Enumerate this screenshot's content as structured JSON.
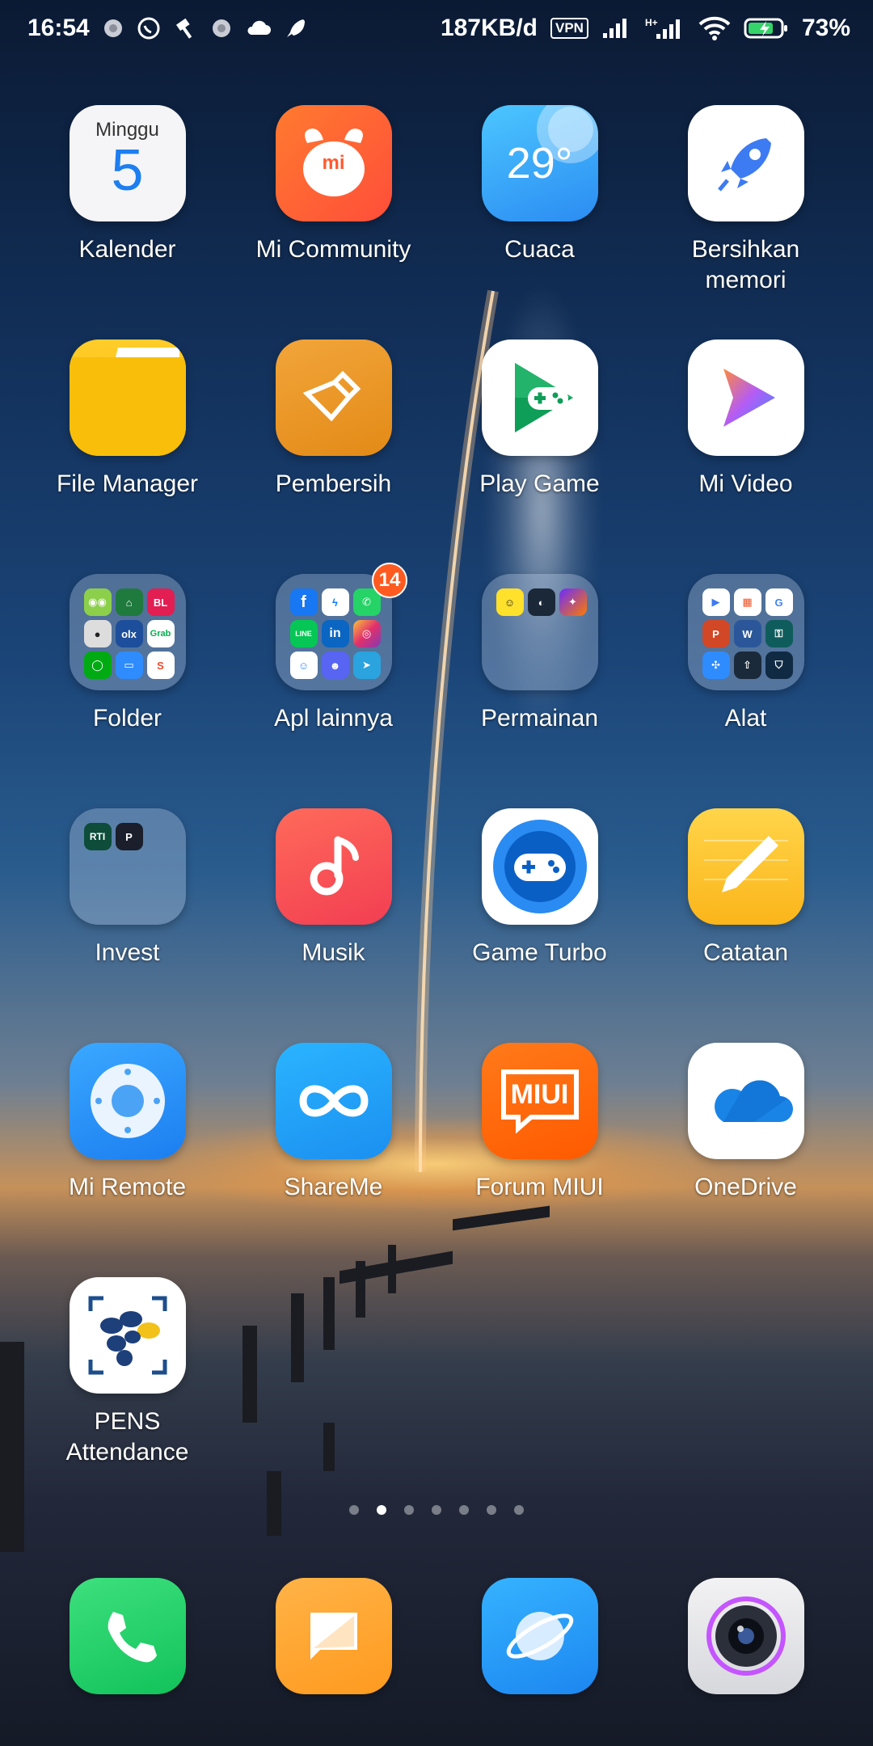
{
  "status_bar": {
    "time": "16:54",
    "speed": "187KB/d",
    "vpn": "VPN",
    "battery": "73%",
    "notification_icons": [
      "circle-icon",
      "whatsapp-icon",
      "hammer-icon",
      "circle-icon",
      "cloud-icon",
      "rocket-icon"
    ]
  },
  "apps": [
    {
      "label": "Kalender",
      "icon": "calendar-icon",
      "day_name": "Minggu",
      "day_number": "5"
    },
    {
      "label": "Mi Community",
      "icon": "mi-community-icon",
      "text": "mi"
    },
    {
      "label": "Cuaca",
      "icon": "weather-icon",
      "temperature": "29°"
    },
    {
      "label": "Bersihkan memori",
      "icon": "rocket-cleaner-icon"
    },
    {
      "label": "File Manager",
      "icon": "folder-file-icon"
    },
    {
      "label": "Pembersih",
      "icon": "brush-cleaner-icon"
    },
    {
      "label": "Play Game",
      "icon": "play-games-icon"
    },
    {
      "label": "Mi Video",
      "icon": "mi-video-icon"
    },
    {
      "label": "Folder",
      "icon": "folder-group-icon",
      "minis": [
        "BL",
        "olx",
        "Grab"
      ]
    },
    {
      "label": "Apl lainnya",
      "icon": "folder-group-icon",
      "badge": "14",
      "minis": [
        "LINE",
        "in"
      ]
    },
    {
      "label": "Permainan",
      "icon": "folder-group-icon"
    },
    {
      "label": "Alat",
      "icon": "folder-group-icon",
      "minis": [
        "P",
        "W"
      ]
    },
    {
      "label": "Invest",
      "icon": "folder-group-icon",
      "minis": [
        "RTI"
      ]
    },
    {
      "label": "Musik",
      "icon": "music-icon"
    },
    {
      "label": "Game Turbo",
      "icon": "game-turbo-icon"
    },
    {
      "label": "Catatan",
      "icon": "notes-icon"
    },
    {
      "label": "Mi Remote",
      "icon": "mi-remote-icon"
    },
    {
      "label": "ShareMe",
      "icon": "shareme-icon"
    },
    {
      "label": "Forum MIUI",
      "icon": "forum-miui-icon",
      "text": "MIUI"
    },
    {
      "label": "OneDrive",
      "icon": "onedrive-icon"
    },
    {
      "label": "PENS Attendance",
      "icon": "pens-attendance-icon"
    }
  ],
  "pages": {
    "count": 7,
    "active": 2
  },
  "dock": [
    {
      "name": "phone",
      "icon": "phone-icon"
    },
    {
      "name": "messages",
      "icon": "message-icon"
    },
    {
      "name": "browser",
      "icon": "browser-icon"
    },
    {
      "name": "camera",
      "icon": "camera-icon"
    }
  ]
}
